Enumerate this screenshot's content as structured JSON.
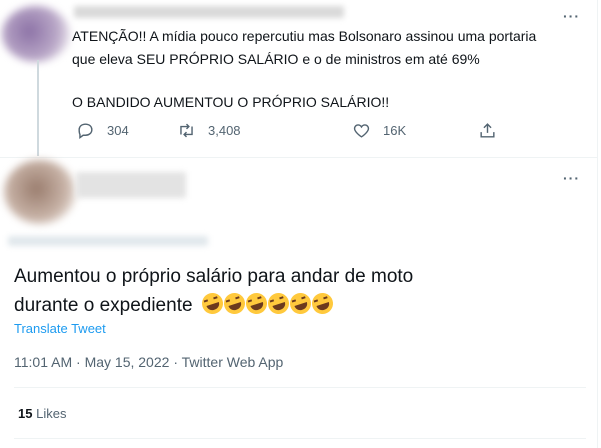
{
  "original_tweet": {
    "more_icon": "more-horizontal-icon",
    "text_lines": [
      "ATENÇÃO!! A mídia pouco repercutiu mas Bolsonaro assinou uma portaria",
      "que eleva SEU PRÓPRIO SALÁRIO e o de ministros em até 69%",
      "O BANDIDO AUMENTOU O PRÓPRIO SALÁRIO!!"
    ],
    "actions": {
      "reply_count": "304",
      "retweet_count": "3,408",
      "like_count": "16K"
    }
  },
  "reply_tweet": {
    "text_line1": "Aumentou o próprio salário para andar de moto",
    "text_line2": "durante o expediente",
    "emoji_count": 6,
    "translate_label": "Translate Tweet",
    "time": "11:01 AM",
    "date": "May 15, 2022",
    "source": "Twitter Web App",
    "likes_count": "15",
    "likes_label": "Likes"
  },
  "colors": {
    "text": "#0f1419",
    "secondary": "#536471",
    "link": "#1d9bf0",
    "divider": "#eff3f4"
  }
}
